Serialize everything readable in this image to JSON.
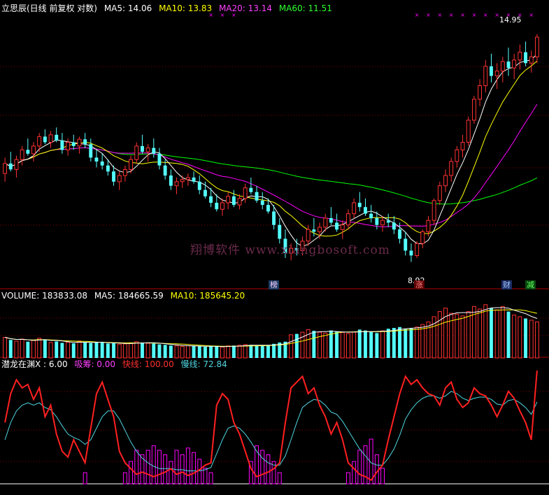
{
  "header": {
    "title": "立思辰(日线 前复权 对数)",
    "ma5": "MA5: 14.06",
    "ma10": "MA10: 13.83",
    "ma20": "MA20: 13.14",
    "ma60": "MA60: 11.51"
  },
  "volume_header": {
    "volume": "VOLUME: 183833.08",
    "ma5": "MA5: 184665.59",
    "ma10": "MA10: 185645.20"
  },
  "indicator_header": {
    "name": "潜龙在渊X : 6.00",
    "xichou": "吸筹: 0.00",
    "kuaixian": "快线: 100.00",
    "manxian": "慢线: 72.84"
  },
  "watermark": "翔博软件 www.xiangbosoft.com",
  "labels": {
    "high_price": "14.95",
    "low_price": "8.92"
  },
  "tags": {
    "t1": "榜",
    "t2": "涨",
    "t3": "财",
    "t4": "减"
  },
  "colors": {
    "up": "#ff3232",
    "down": "#54ffff",
    "ma5": "#ffffff",
    "ma10": "#ffff00",
    "ma20": "#ff00ff",
    "ma60": "#00ff00",
    "grid": "#8a0000",
    "fast_line": "#ff2020",
    "slow_line": "#4fd6e0",
    "xichou": "#ff00ff"
  },
  "chart_data": [
    {
      "type": "candlestick",
      "label": "price",
      "yscale": "log",
      "ylim": [
        8.5,
        15.6
      ],
      "ohlc": [
        [
          10.9,
          11.3,
          10.7,
          11.15
        ],
        [
          11.15,
          11.45,
          10.95,
          11.0
        ],
        [
          11.0,
          11.35,
          10.8,
          11.25
        ],
        [
          11.25,
          11.6,
          11.1,
          11.5
        ],
        [
          11.5,
          11.8,
          11.35,
          11.4
        ],
        [
          11.4,
          11.7,
          11.2,
          11.6
        ],
        [
          11.6,
          11.95,
          11.45,
          11.85
        ],
        [
          11.85,
          12.05,
          11.65,
          11.7
        ],
        [
          11.7,
          12.0,
          11.55,
          11.9
        ],
        [
          11.9,
          12.1,
          11.7,
          11.75
        ],
        [
          11.75,
          11.95,
          11.4,
          11.5
        ],
        [
          11.5,
          11.8,
          11.35,
          11.7
        ],
        [
          11.7,
          11.9,
          11.5,
          11.6
        ],
        [
          11.6,
          11.85,
          11.4,
          11.78
        ],
        [
          11.78,
          11.95,
          11.55,
          11.65
        ],
        [
          11.65,
          11.8,
          11.2,
          11.3
        ],
        [
          11.3,
          11.5,
          11.05,
          11.2
        ],
        [
          11.2,
          11.4,
          11.0,
          11.1
        ],
        [
          11.1,
          11.25,
          10.85,
          10.95
        ],
        [
          10.95,
          11.1,
          10.6,
          10.7
        ],
        [
          10.7,
          10.95,
          10.5,
          10.85
        ],
        [
          10.85,
          11.1,
          10.7,
          11.0
        ],
        [
          11.0,
          11.35,
          10.9,
          11.25
        ],
        [
          11.25,
          11.7,
          11.15,
          11.6
        ],
        [
          11.6,
          11.9,
          11.4,
          11.45
        ],
        [
          11.45,
          11.65,
          11.2,
          11.55
        ],
        [
          11.55,
          11.8,
          11.3,
          11.4
        ],
        [
          11.4,
          11.55,
          11.0,
          11.1
        ],
        [
          11.1,
          11.25,
          10.75,
          10.85
        ],
        [
          10.85,
          11.0,
          10.5,
          10.6
        ],
        [
          10.6,
          10.8,
          10.4,
          10.7
        ],
        [
          10.7,
          10.85,
          10.55,
          10.75
        ],
        [
          10.75,
          10.9,
          10.6,
          10.8
        ],
        [
          10.8,
          10.95,
          10.65,
          10.7
        ],
        [
          10.7,
          10.85,
          10.4,
          10.5
        ],
        [
          10.5,
          10.7,
          10.3,
          10.35
        ],
        [
          10.35,
          10.55,
          10.1,
          10.2
        ],
        [
          10.2,
          10.4,
          10.0,
          10.05
        ],
        [
          10.05,
          10.3,
          9.9,
          10.2
        ],
        [
          10.2,
          10.45,
          10.05,
          10.35
        ],
        [
          10.35,
          10.5,
          10.1,
          10.15
        ],
        [
          10.15,
          10.4,
          10.05,
          10.3
        ],
        [
          10.3,
          10.65,
          10.2,
          10.55
        ],
        [
          10.55,
          10.8,
          10.4,
          10.45
        ],
        [
          10.45,
          10.6,
          10.2,
          10.25
        ],
        [
          10.25,
          10.45,
          10.05,
          10.15
        ],
        [
          10.15,
          10.3,
          9.95,
          10.0
        ],
        [
          10.0,
          10.15,
          9.6,
          9.7
        ],
        [
          9.7,
          9.85,
          9.3,
          9.4
        ],
        [
          9.4,
          9.6,
          9.0,
          9.1
        ],
        [
          9.1,
          9.3,
          8.95,
          9.2
        ],
        [
          9.2,
          9.4,
          9.05,
          9.15
        ],
        [
          9.15,
          9.45,
          9.05,
          9.35
        ],
        [
          9.35,
          9.7,
          9.25,
          9.6
        ],
        [
          9.6,
          9.85,
          9.45,
          9.55
        ],
        [
          9.55,
          9.75,
          9.4,
          9.65
        ],
        [
          9.65,
          9.95,
          9.55,
          9.85
        ],
        [
          9.85,
          10.1,
          9.7,
          9.75
        ],
        [
          9.75,
          9.95,
          9.55,
          9.6
        ],
        [
          9.6,
          9.8,
          9.4,
          9.7
        ],
        [
          9.7,
          10.05,
          9.6,
          9.95
        ],
        [
          9.95,
          10.3,
          9.85,
          10.2
        ],
        [
          10.2,
          10.45,
          10.0,
          10.1
        ],
        [
          10.1,
          10.3,
          9.9,
          9.95
        ],
        [
          9.95,
          10.15,
          9.75,
          9.85
        ],
        [
          9.85,
          10.0,
          9.6,
          9.7
        ],
        [
          9.7,
          9.9,
          9.55,
          9.8
        ],
        [
          9.8,
          9.95,
          9.65,
          9.75
        ],
        [
          9.75,
          9.9,
          9.5,
          9.6
        ],
        [
          9.6,
          9.75,
          9.3,
          9.4
        ],
        [
          9.4,
          9.55,
          9.05,
          9.15
        ],
        [
          9.15,
          9.3,
          8.92,
          9.05
        ],
        [
          9.05,
          9.35,
          9.0,
          9.3
        ],
        [
          9.3,
          9.6,
          9.2,
          9.55
        ],
        [
          9.55,
          9.9,
          9.45,
          9.8
        ],
        [
          9.8,
          10.3,
          9.7,
          10.25
        ],
        [
          10.25,
          10.7,
          10.15,
          10.6
        ],
        [
          10.6,
          11.0,
          10.45,
          10.85
        ],
        [
          10.85,
          11.3,
          10.7,
          11.2
        ],
        [
          11.2,
          11.6,
          11.05,
          11.5
        ],
        [
          11.5,
          11.9,
          11.3,
          11.7
        ],
        [
          11.7,
          12.4,
          11.6,
          12.3
        ],
        [
          12.3,
          13.0,
          12.2,
          12.9
        ],
        [
          12.9,
          13.5,
          12.7,
          13.3
        ],
        [
          13.3,
          14.1,
          13.1,
          13.9
        ],
        [
          13.9,
          14.3,
          13.4,
          13.6
        ],
        [
          13.6,
          14.0,
          13.2,
          13.75
        ],
        [
          13.75,
          14.2,
          13.4,
          14.05
        ],
        [
          14.05,
          14.5,
          13.6,
          13.85
        ],
        [
          13.85,
          14.3,
          13.5,
          14.1
        ],
        [
          14.1,
          14.6,
          13.8,
          14.35
        ],
        [
          14.35,
          14.7,
          13.9,
          14.0
        ],
        [
          14.0,
          14.4,
          13.7,
          14.2
        ],
        [
          14.2,
          14.95,
          14.0,
          14.85
        ]
      ]
    },
    {
      "type": "bar",
      "label": "volume",
      "values": [
        120000,
        105000,
        98000,
        110000,
        95000,
        102000,
        115000,
        108000,
        90000,
        96000,
        88000,
        92000,
        85000,
        99000,
        91000,
        87000,
        93000,
        89000,
        84000,
        86000,
        80000,
        82000,
        88000,
        95000,
        90000,
        86000,
        84000,
        79000,
        76000,
        72000,
        70000,
        68000,
        71000,
        69000,
        67000,
        65000,
        68000,
        66000,
        64000,
        70000,
        72000,
        74000,
        78000,
        76000,
        73000,
        71000,
        75000,
        82000,
        90000,
        95000,
        135000,
        140000,
        150000,
        165000,
        158000,
        150000,
        145000,
        160000,
        155000,
        148000,
        142000,
        150000,
        165000,
        160000,
        152000,
        145000,
        158000,
        170000,
        175000,
        180000,
        168000,
        172000,
        180000,
        195000,
        210000,
        240000,
        270000,
        290000,
        260000,
        255000,
        245000,
        270000,
        300000,
        285000,
        310000,
        290000,
        280000,
        300000,
        270000,
        250000,
        240000,
        230000,
        220000,
        210000
      ]
    },
    {
      "type": "line",
      "label": "indicator",
      "ylim": [
        0,
        100
      ],
      "series": [
        {
          "name": "快线",
          "values": [
            55,
            80,
            92,
            85,
            88,
            75,
            85,
            60,
            70,
            45,
            30,
            25,
            40,
            30,
            20,
            50,
            80,
            90,
            75,
            60,
            30,
            20,
            15,
            10,
            12,
            10,
            8,
            10,
            12,
            15,
            10,
            12,
            9,
            11,
            14,
            18,
            20,
            70,
            80,
            75,
            55,
            45,
            30,
            15,
            8,
            10,
            12,
            15,
            20,
            55,
            85,
            90,
            95,
            80,
            85,
            70,
            60,
            45,
            55,
            40,
            20,
            15,
            10,
            8,
            5,
            12,
            18,
            40,
            60,
            80,
            95,
            88,
            92,
            85,
            80,
            78,
            70,
            85,
            90,
            75,
            68,
            72,
            85,
            80,
            78,
            70,
            60,
            70,
            82,
            76,
            65,
            55,
            40,
            100
          ]
        },
        {
          "name": "慢线",
          "values": [
            40,
            55,
            65,
            70,
            72,
            70,
            72,
            68,
            66,
            60,
            52,
            45,
            42,
            40,
            36,
            40,
            50,
            60,
            65,
            65,
            58,
            48,
            38,
            30,
            24,
            20,
            17,
            15,
            15,
            15,
            14,
            14,
            13,
            13,
            13,
            14,
            16,
            28,
            40,
            50,
            52,
            50,
            45,
            38,
            30,
            24,
            20,
            18,
            18,
            26,
            40,
            55,
            68,
            72,
            75,
            74,
            70,
            64,
            62,
            56,
            48,
            40,
            32,
            26,
            20,
            18,
            18,
            24,
            32,
            44,
            58,
            66,
            72,
            76,
            78,
            78,
            76,
            78,
            82,
            80,
            76,
            74,
            76,
            77,
            77,
            75,
            71,
            70,
            74,
            75,
            72,
            68,
            62,
            72.84
          ]
        }
      ]
    }
  ]
}
